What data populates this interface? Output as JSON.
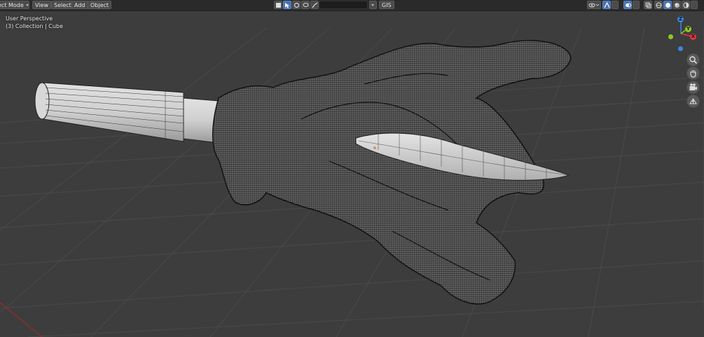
{
  "header": {
    "mode_label": "ect Mode",
    "menus": [
      "View",
      "Select",
      "Add",
      "Object"
    ],
    "search_placeholder": "",
    "gis_label": "GIS"
  },
  "overlay": {
    "perspective": "User Perspective",
    "collection": "(3) Collection | Cube"
  },
  "gizmo": {
    "z_label": "Z",
    "y_label": "Y",
    "x_label": "X",
    "x_color": "#e8363d",
    "y_color": "#8ac926",
    "z_color": "#3a85e0"
  },
  "colors": {
    "viewport_bg": "#3d3d3d",
    "grid": "#4a4a4a",
    "header_bg": "#2a2a2a",
    "accent": "#4772b3",
    "x_axis_line": "#8a2d30"
  },
  "nav_icons": [
    "zoom-icon",
    "hand-pan-icon",
    "camera-icon",
    "grid-icon"
  ]
}
